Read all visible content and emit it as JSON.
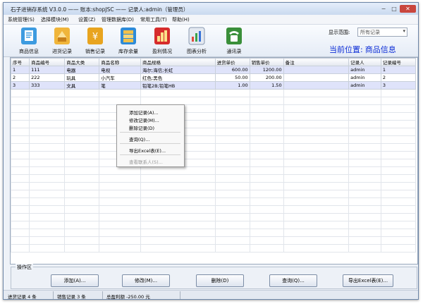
{
  "window": {
    "title": "石子进销存系统 V3.0.0 —— 账本:shopJSC —— 记录人:admin（管理员）",
    "controls": {
      "minimize": "−",
      "maximize": "□",
      "close": "✕"
    }
  },
  "menu": [
    "系统管理(S)",
    "选择模块(M)",
    "设置(Z)",
    "管理数据库(D)",
    "常用工具(T)",
    "帮助(H)"
  ],
  "toolbar": {
    "items": [
      {
        "label": "商品信息",
        "icon": "goods-info-icon",
        "color": "#3d9be0"
      },
      {
        "label": "进货记录",
        "icon": "purchase-record-icon",
        "color": "#e3a21d"
      },
      {
        "label": "销售记录",
        "icon": "sales-record-icon",
        "color": "#e8a41f"
      },
      {
        "label": "库存余量",
        "icon": "stock-icon",
        "color": "#2e8bd8"
      },
      {
        "label": "盈利情况",
        "icon": "profit-icon",
        "color": "#d62c2c"
      },
      {
        "label": "图表分析",
        "icon": "chart-analysis-icon",
        "color": "#6d7f99"
      },
      {
        "label": "通讯录",
        "icon": "contacts-icon",
        "color": "#3a8f3a"
      }
    ],
    "scope_label": "显示范围:",
    "scope_value": "所有记录",
    "location_label": "当前位置:",
    "location_value": "商品信息"
  },
  "table": {
    "columns": [
      "序号",
      "商品编号",
      "商品大类",
      "商品名称",
      "商品规格",
      "进货单价",
      "销售单价",
      "备注",
      "记录人",
      "记录编号"
    ],
    "rows": [
      [
        "1",
        "111",
        "电器",
        "电视",
        "海尔;海信;长虹",
        "600.00",
        "1200.00",
        "",
        "admin",
        "1"
      ],
      [
        "2",
        "222",
        "玩具",
        "小汽车",
        "红色;黑色",
        "50.00",
        "200.00",
        "",
        "admin",
        "2"
      ],
      [
        "3",
        "333",
        "文具",
        "笔",
        "铅笔2B;铅笔HB",
        "1.00",
        "1.50",
        "",
        "admin",
        "3"
      ]
    ]
  },
  "context_menu": {
    "items": [
      {
        "label": "添加记录(A)...",
        "enabled": true
      },
      {
        "label": "修改记录(M)...",
        "enabled": true
      },
      {
        "label": "删除记录(D)",
        "enabled": true
      },
      {
        "label": "查询(Q)...",
        "enabled": true
      },
      {
        "label": "导出Excel表(E)...",
        "enabled": true
      },
      {
        "label": "查看联系人(S)...",
        "enabled": false
      }
    ]
  },
  "operations": {
    "title": "操作区",
    "buttons": [
      "添加(A)...",
      "修改(M)...",
      "删除(D)",
      "查询(Q)...",
      "导出Excel表(E)..."
    ]
  },
  "status": {
    "purchase": "进货记录 4 条",
    "sales": "销售记录 3 条",
    "profit": "总盈利额 -250.00 元"
  }
}
